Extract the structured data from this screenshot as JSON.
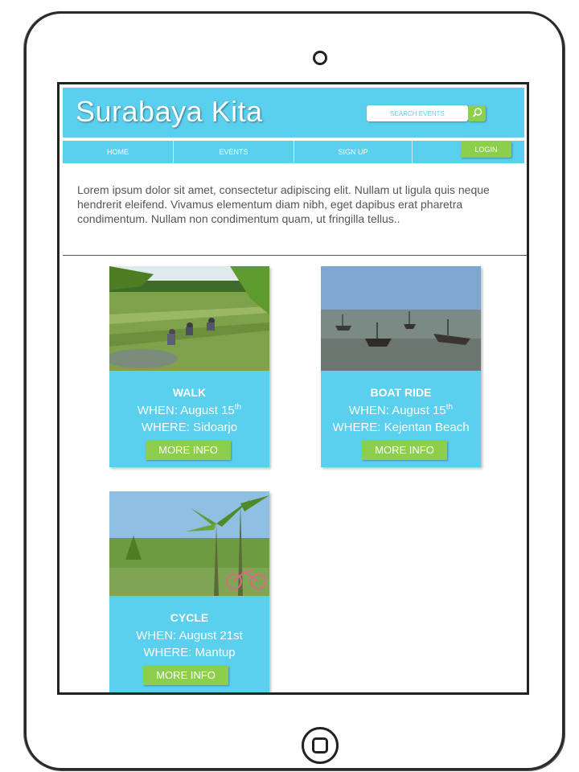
{
  "header": {
    "title": "Surabaya Kita"
  },
  "search": {
    "placeholder": "SEARCH EVENTS",
    "icon": "search-icon"
  },
  "nav": {
    "items": [
      "HOME",
      "EVENTS",
      "SIGN UP"
    ],
    "login_label": "LOGIN"
  },
  "intro": {
    "text": "Lorem ipsum dolor sit amet, consectetur adipiscing elit. Nullam ut ligula quis neque hendrerit eleifend. Vivamus elementum diam nibh, eget dapibus erat pharetra condimentum. Nullam non condimentum quam, ut fringilla tellus.."
  },
  "events": [
    {
      "title": "WALK",
      "when_prefix": "WHEN: August 15",
      "when_sup": "th",
      "where": "WHERE: Sidoarjo",
      "button": "MORE INFO",
      "image": "rice-field-photo"
    },
    {
      "title": "BOAT RIDE",
      "when_prefix": "WHEN: August 15",
      "when_sup": "th",
      "where": "WHERE: Kejentan Beach",
      "button": "MORE INFO",
      "image": "boats-photo"
    },
    {
      "title": "CYCLE",
      "when_prefix": "WHEN: August 21st",
      "when_sup": "",
      "where": "WHERE: Mantup",
      "button": "MORE INFO",
      "image": "banana-trees-bicycle-photo"
    }
  ],
  "colors": {
    "accent": "#5bcfee",
    "button_green": "#8ccf4d"
  }
}
